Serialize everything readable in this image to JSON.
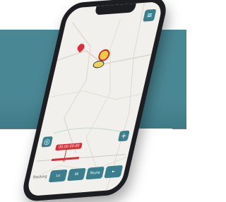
{
  "map": {
    "menu_icon": "hamburger-menu-icon",
    "marker_icon": "location-pin-icon",
    "poi_icon": "route-marker-icon"
  },
  "controls": {
    "left_button_icon": "crosshair-icon",
    "right_button_icon": "plus-icon",
    "red_label": "00:00 00:00"
  },
  "toolbar": {
    "label": "Tracking",
    "buttons": [
      {
        "label": "Lo"
      },
      {
        "label": "Mi"
      },
      {
        "label": "Route"
      },
      {
        "label": "►"
      }
    ]
  },
  "colors": {
    "teal": "#4a8794",
    "button_teal": "#3b7e8d",
    "accent_red": "#d8303a"
  }
}
